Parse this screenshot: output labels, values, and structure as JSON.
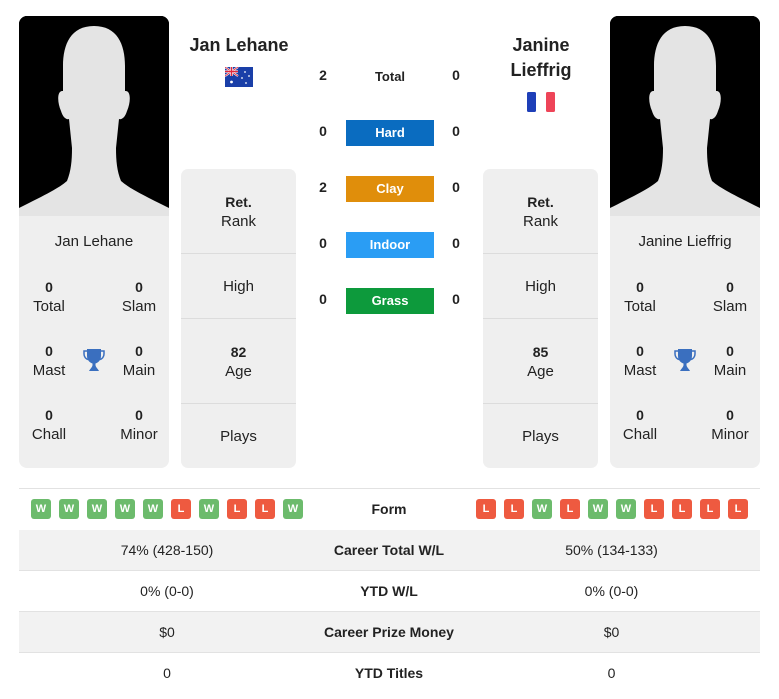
{
  "player1": {
    "name": "Jan Lehane",
    "card_name": "Jan Lehane",
    "flag": "australia-flag",
    "titles": {
      "total": {
        "value": "0",
        "label": "Total"
      },
      "slam": {
        "value": "0",
        "label": "Slam"
      },
      "mast": {
        "value": "0",
        "label": "Mast"
      },
      "main": {
        "value": "0",
        "label": "Main"
      },
      "chall": {
        "value": "0",
        "label": "Chall"
      },
      "minor": {
        "value": "0",
        "label": "Minor"
      }
    },
    "info": {
      "rank_value": "Ret.",
      "rank_label": "Rank",
      "high_label": "High",
      "age_value": "82",
      "age_label": "Age",
      "plays_label": "Plays"
    },
    "form": [
      "W",
      "W",
      "W",
      "W",
      "W",
      "L",
      "W",
      "L",
      "L",
      "W"
    ],
    "career_wl": "74% (428-150)",
    "ytd_wl": "0% (0-0)",
    "prize": "$0",
    "ytd_titles": "0"
  },
  "player2": {
    "name_line1": "Janine",
    "name_line2": "Lieffrig",
    "card_name": "Janine Lieffrig",
    "flag": "france-flag",
    "titles": {
      "total": {
        "value": "0",
        "label": "Total"
      },
      "slam": {
        "value": "0",
        "label": "Slam"
      },
      "mast": {
        "value": "0",
        "label": "Mast"
      },
      "main": {
        "value": "0",
        "label": "Main"
      },
      "chall": {
        "value": "0",
        "label": "Chall"
      },
      "minor": {
        "value": "0",
        "label": "Minor"
      }
    },
    "info": {
      "rank_value": "Ret.",
      "rank_label": "Rank",
      "high_label": "High",
      "age_value": "85",
      "age_label": "Age",
      "plays_label": "Plays"
    },
    "form": [
      "L",
      "L",
      "W",
      "L",
      "W",
      "W",
      "L",
      "L",
      "L",
      "L"
    ],
    "career_wl": "50% (134-133)",
    "ytd_wl": "0% (0-0)",
    "prize": "$0",
    "ytd_titles": "0"
  },
  "h2h": {
    "total": {
      "label": "Total",
      "p1": "2",
      "p2": "0"
    },
    "surfaces": [
      {
        "label": "Hard",
        "p1": "0",
        "p2": "0",
        "color": "#0a6cc0"
      },
      {
        "label": "Clay",
        "p1": "2",
        "p2": "0",
        "color": "#e08e0b"
      },
      {
        "label": "Indoor",
        "p1": "0",
        "p2": "0",
        "color": "#2a9df4"
      },
      {
        "label": "Grass",
        "p1": "0",
        "p2": "0",
        "color": "#0d9a3c"
      }
    ]
  },
  "table": {
    "form_label": "Form",
    "career_wl_label": "Career Total W/L",
    "ytd_wl_label": "YTD W/L",
    "prize_label": "Career Prize Money",
    "ytd_titles_label": "YTD Titles"
  },
  "colors": {
    "win": "#6cbb6c",
    "loss": "#ee5a40",
    "trophy": "#3a6fbf"
  }
}
